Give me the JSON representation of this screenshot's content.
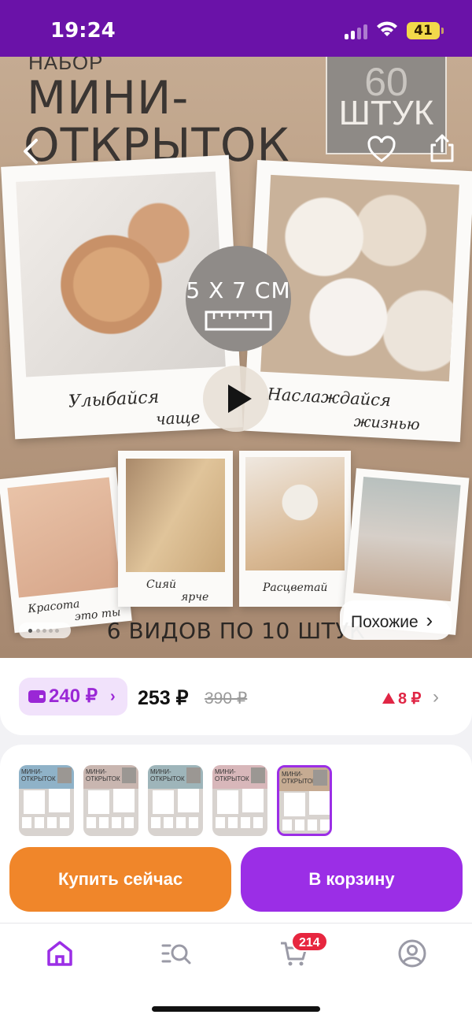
{
  "status_bar": {
    "time": "19:24",
    "battery": "41"
  },
  "hero": {
    "kicker": "НАБОР",
    "title_line1": "МИНИ-",
    "title_line2": "ОТКРЫТОК",
    "qty_number": "60",
    "qty_unit": "ШТУК",
    "size_label": "5 X 7 СМ",
    "card_captions": [
      {
        "line1": "Улыбайся",
        "line2": "чаще"
      },
      {
        "line1": "Наслаждайся",
        "line2": "жизнью"
      },
      {
        "line1": "Красота",
        "line2": "это ты"
      },
      {
        "line1": "Сияй",
        "line2": "ярче"
      },
      {
        "line1": "Расцветай",
        "line2": ""
      }
    ],
    "bottom_text": "6 ВИДОВ ПО 10 ШТУК",
    "similar_label": "Похожие",
    "similar_chevron": "›",
    "gallery": {
      "current": 1,
      "total": 5
    }
  },
  "price": {
    "wallet_price": "240 ₽",
    "wallet_chevron": "›",
    "current": "253 ₽",
    "old": "390 ₽",
    "diff": "8 ₽",
    "diff_chevron": "›"
  },
  "variants": {
    "thumb_title": "МИНИ-ОТКРЫТОК",
    "selected_index": 4,
    "colors": [
      "#8fb2c8",
      "#c9b6b0",
      "#9eb5ba",
      "#d8b7ba",
      "#c6ab92"
    ]
  },
  "actions": {
    "buy_now": "Купить сейчас",
    "add_to_cart": "В корзину"
  },
  "tabbar": {
    "items": [
      "home-icon",
      "catalog-search-icon",
      "cart-icon",
      "profile-icon"
    ],
    "cart_badge": "214",
    "active_color": "#9b2ee6",
    "inactive_color": "#9a9aa6"
  }
}
